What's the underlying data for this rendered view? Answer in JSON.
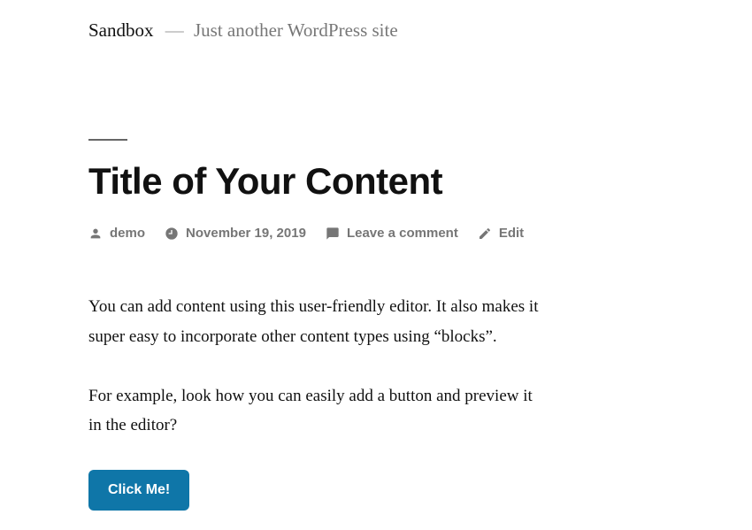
{
  "header": {
    "site_title": "Sandbox",
    "separator": "—",
    "tagline": "Just another WordPress site"
  },
  "post": {
    "title": "Title of Your Content",
    "meta": {
      "author": "demo",
      "date": "November 19, 2019",
      "comments_label": "Leave a comment",
      "edit_label": "Edit"
    },
    "paragraphs": [
      "You can add content using this user-friendly editor. It also makes it super easy to incorporate other content types using “blocks”.",
      "For example, look how you can easily add a button and preview it in the editor?"
    ],
    "button_label": "Click Me!"
  },
  "colors": {
    "button_bg": "#0f76a8"
  }
}
